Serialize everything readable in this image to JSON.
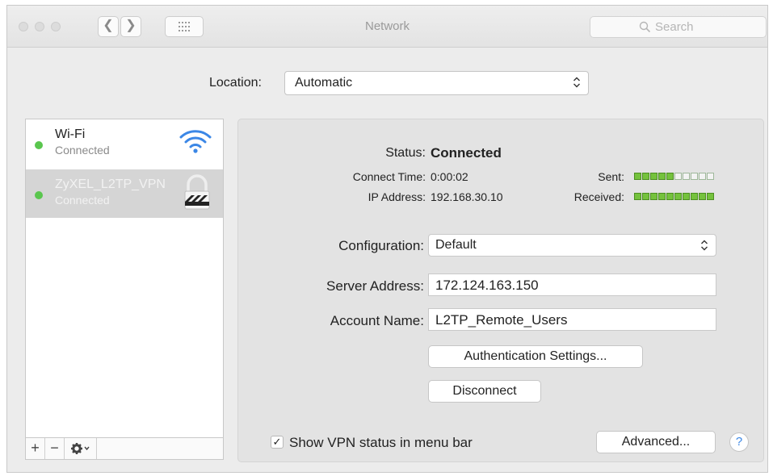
{
  "window": {
    "title": "Network"
  },
  "search": {
    "placeholder": "Search"
  },
  "location": {
    "label": "Location:",
    "value": "Automatic"
  },
  "sidebar": {
    "services": [
      {
        "name": "Wi-Fi",
        "status": "Connected",
        "icon": "wifi-icon",
        "status_color": "#5ac64e"
      },
      {
        "name": "ZyXEL_L2TP_VPN",
        "status": "Connected",
        "icon": "lock-icon",
        "status_color": "#5ac64e"
      }
    ],
    "toolbar": {
      "add": "+",
      "remove": "−"
    }
  },
  "details": {
    "status_label": "Status:",
    "status_value": "Connected",
    "connect_time_label": "Connect Time:",
    "connect_time_value": "0:00:02",
    "ip_label": "IP Address:",
    "ip_value": "192.168.30.10",
    "sent_label": "Sent:",
    "sent_level": 5,
    "received_label": "Received:",
    "received_level": 10,
    "meter_segments": 10,
    "configuration_label": "Configuration:",
    "configuration_value": "Default",
    "server_label": "Server Address:",
    "server_value": "172.124.163.150",
    "account_label": "Account Name:",
    "account_value": "L2TP_Remote_Users",
    "auth_button": "Authentication Settings...",
    "disconnect_button": "Disconnect",
    "show_vpn_label": "Show VPN status in menu bar",
    "show_vpn_checked": true,
    "advanced_button": "Advanced...",
    "help_button": "?"
  },
  "colors": {
    "status_green": "#5ac64e",
    "meter_on": "#75c23d",
    "help_blue": "#3b87e6"
  }
}
